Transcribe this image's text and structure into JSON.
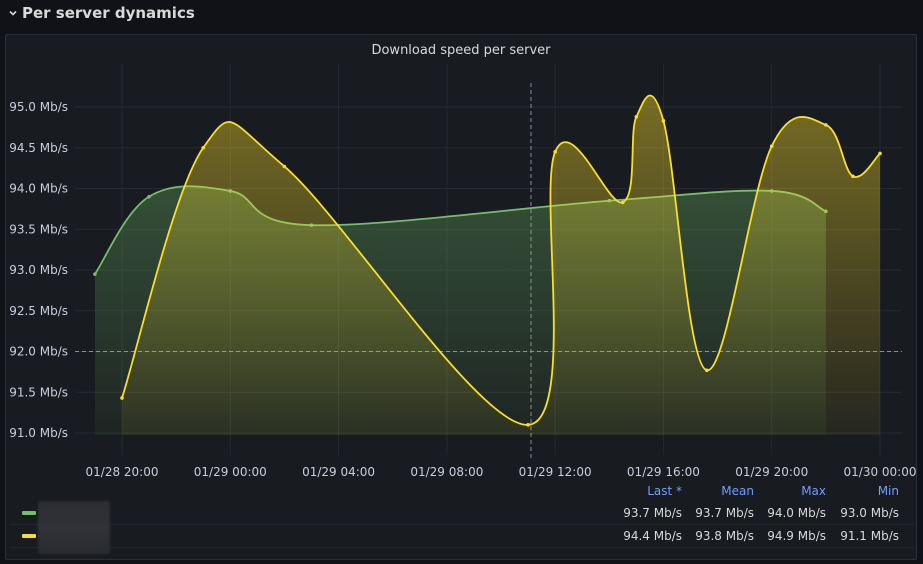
{
  "row": {
    "title": "Per server dynamics"
  },
  "panel": {
    "title": "Download speed per server"
  },
  "colors": {
    "green": "#73bf69",
    "yellow": "#fade2a",
    "grid": "#2b2e35",
    "text": "#ccccdc",
    "accent": "#6e9fff"
  },
  "legend": {
    "headers": [
      "Last *",
      "Mean",
      "Max",
      "Min"
    ],
    "rows": [
      {
        "color": "#73bf69",
        "values": [
          "93.7 Mb/s",
          "93.7 Mb/s",
          "94.0 Mb/s",
          "93.0 Mb/s"
        ]
      },
      {
        "color": "#fade2a",
        "values": [
          "94.4 Mb/s",
          "93.8 Mb/s",
          "94.9 Mb/s",
          "91.1 Mb/s"
        ]
      }
    ]
  },
  "chart_data": {
    "type": "area",
    "x_tick_labels": [
      "01/28 20:00",
      "01/29 00:00",
      "01/29 04:00",
      "01/29 08:00",
      "01/29 12:00",
      "01/29 16:00",
      "01/29 20:00",
      "01/30 00:00"
    ],
    "y_tick_labels": [
      "91.0 Mb/s",
      "91.5 Mb/s",
      "92.0 Mb/s",
      "92.5 Mb/s",
      "93.0 Mb/s",
      "93.5 Mb/s",
      "94.0 Mb/s",
      "94.5 Mb/s",
      "95.0 Mb/s"
    ],
    "y_ticks": [
      91.0,
      91.5,
      92.0,
      92.5,
      93.0,
      93.5,
      94.0,
      94.5,
      95.0
    ],
    "ylim": [
      90.85,
      95.25
    ],
    "xlim_hours": [
      -0.8,
      28.0
    ],
    "threshold": 92.0,
    "crosshair_hour": 15.0,
    "grid": true,
    "series": [
      {
        "color": "#73bf69",
        "points": [
          [
            -1.0,
            92.95
          ],
          [
            1.0,
            93.9
          ],
          [
            4.0,
            93.97
          ],
          [
            7.0,
            93.55
          ],
          [
            18.0,
            93.85
          ],
          [
            24.0,
            93.97
          ],
          [
            26.0,
            93.72
          ]
        ]
      },
      {
        "color": "#fade2a",
        "points": [
          [
            0.0,
            91.43
          ],
          [
            3.0,
            94.5
          ],
          [
            6.0,
            94.27
          ],
          [
            15.0,
            91.1
          ],
          [
            16.0,
            94.45
          ],
          [
            18.5,
            93.83
          ],
          [
            19.0,
            94.88
          ],
          [
            20.0,
            94.83
          ],
          [
            21.6,
            91.77
          ],
          [
            24.0,
            94.52
          ],
          [
            26.0,
            94.78
          ],
          [
            27.0,
            94.15
          ],
          [
            28.0,
            94.43
          ]
        ]
      }
    ]
  }
}
